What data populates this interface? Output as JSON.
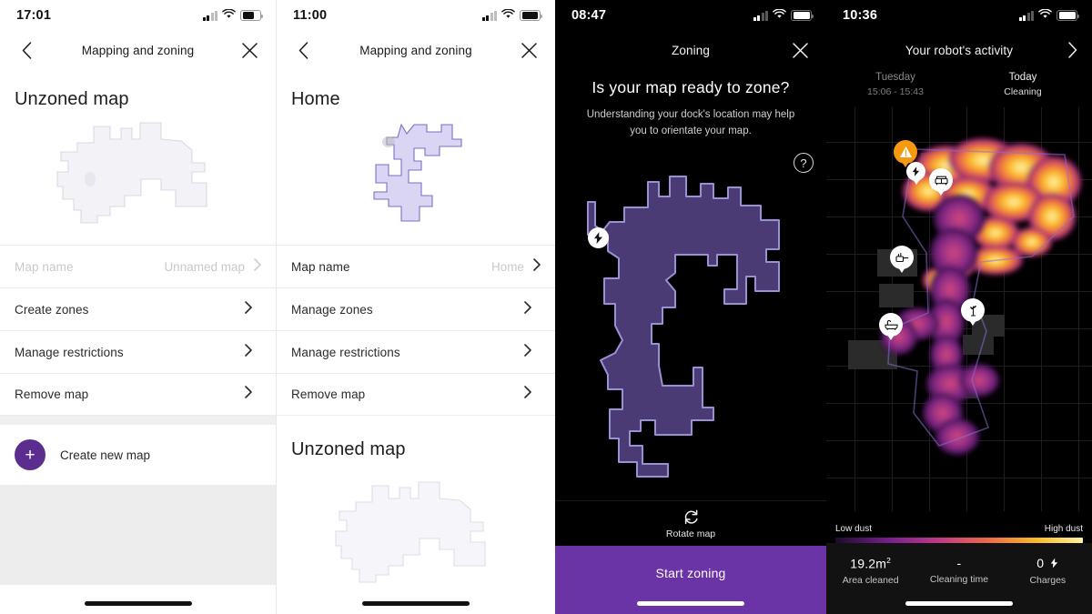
{
  "panels": [
    {
      "id": "mapping-unzoned",
      "status": {
        "time": "17:01",
        "signal_icon": "signal-bars-icon",
        "wifi_icon": "wifi-icon",
        "battery_icon": "battery-icon",
        "battery_level": 62
      },
      "nav": {
        "back_icon": "chevron-left-icon",
        "title": "Mapping and zoning",
        "close_icon": "close-icon"
      },
      "section_title": "Unzoned map",
      "rows": [
        {
          "label": "Map name",
          "value": "Unnamed map",
          "muted": true,
          "chevron_icon": "chevron-right-icon"
        },
        {
          "label": "Create zones",
          "value": "",
          "muted": false,
          "chevron_icon": "chevron-right-icon"
        },
        {
          "label": "Manage restrictions",
          "value": "",
          "muted": false,
          "chevron_icon": "chevron-right-icon"
        },
        {
          "label": "Remove map",
          "value": "",
          "muted": false,
          "chevron_icon": "chevron-right-icon"
        }
      ],
      "create": {
        "icon": "plus-icon",
        "label": "Create new map",
        "color": "#5B2D8E"
      }
    },
    {
      "id": "mapping-home",
      "status": {
        "time": "11:00",
        "signal_icon": "signal-bars-icon",
        "wifi_icon": "wifi-icon",
        "battery_icon": "battery-icon",
        "battery_level": 88
      },
      "nav": {
        "back_icon": "chevron-left-icon",
        "title": "Mapping and zoning",
        "close_icon": "close-icon"
      },
      "section_title": "Home",
      "rows": [
        {
          "label": "Map name",
          "value": "Home",
          "muted": false,
          "chevron_icon": "chevron-right-icon"
        },
        {
          "label": "Manage zones",
          "value": "",
          "muted": false,
          "chevron_icon": "chevron-right-icon"
        },
        {
          "label": "Manage restrictions",
          "value": "",
          "muted": false,
          "chevron_icon": "chevron-right-icon"
        },
        {
          "label": "Remove map",
          "value": "",
          "muted": false,
          "chevron_icon": "chevron-right-icon"
        }
      ],
      "second_section_title": "Unzoned map"
    },
    {
      "id": "zoning",
      "status": {
        "time": "08:47",
        "signal_icon": "signal-bars-icon",
        "wifi_icon": "wifi-icon",
        "battery_icon": "battery-icon",
        "battery_level": 92
      },
      "nav": {
        "title": "Zoning",
        "close_icon": "close-icon"
      },
      "heading": "Is your map ready to zone?",
      "subheading": "Understanding your dock's location may help you to orientate your map.",
      "help_icon": "question-mark-icon",
      "dock_icon": "charging-bolt-icon",
      "rotate": {
        "icon": "rotate-icon",
        "label": "Rotate map"
      },
      "primary_button": {
        "label": "Start zoning",
        "color": "#6A33A6"
      },
      "map_fill": "#4A3B74",
      "map_stroke": "#9B8FD6"
    },
    {
      "id": "robot-activity",
      "status": {
        "time": "10:36",
        "signal_icon": "signal-bars-icon",
        "wifi_icon": "wifi-icon",
        "battery_icon": "battery-icon",
        "battery_level": 95
      },
      "nav": {
        "title": "Your robot's activity",
        "forward_icon": "chevron-right-icon"
      },
      "dates": [
        {
          "day": "Tuesday",
          "time": "15:06 - 15:43",
          "current": false
        },
        {
          "day": "Today",
          "time": "Cleaning",
          "current": true
        }
      ],
      "pins": [
        {
          "icon": "warning-icon",
          "kind": "warn"
        },
        {
          "icon": "charging-bolt-icon",
          "kind": "small"
        },
        {
          "icon": "sofa-icon",
          "kind": "normal"
        },
        {
          "icon": "kitchen-icon",
          "kind": "normal"
        },
        {
          "icon": "plant-icon",
          "kind": "normal"
        },
        {
          "icon": "bathtub-icon",
          "kind": "normal"
        }
      ],
      "legend": {
        "low": "Low dust",
        "high": "High dust",
        "gradient": [
          "#1b0b2e",
          "#7b1f8f",
          "#c0398a",
          "#ef6b45",
          "#fbbd2a",
          "#fff3a0"
        ]
      },
      "stats": [
        {
          "value": "19.2m",
          "superscript": "2",
          "label": "Area cleaned"
        },
        {
          "value": "-",
          "superscript": "",
          "label": "Cleaning time"
        },
        {
          "value": "0",
          "superscript": "",
          "label": "Charges",
          "icon": "bolt-icon"
        }
      ]
    }
  ]
}
